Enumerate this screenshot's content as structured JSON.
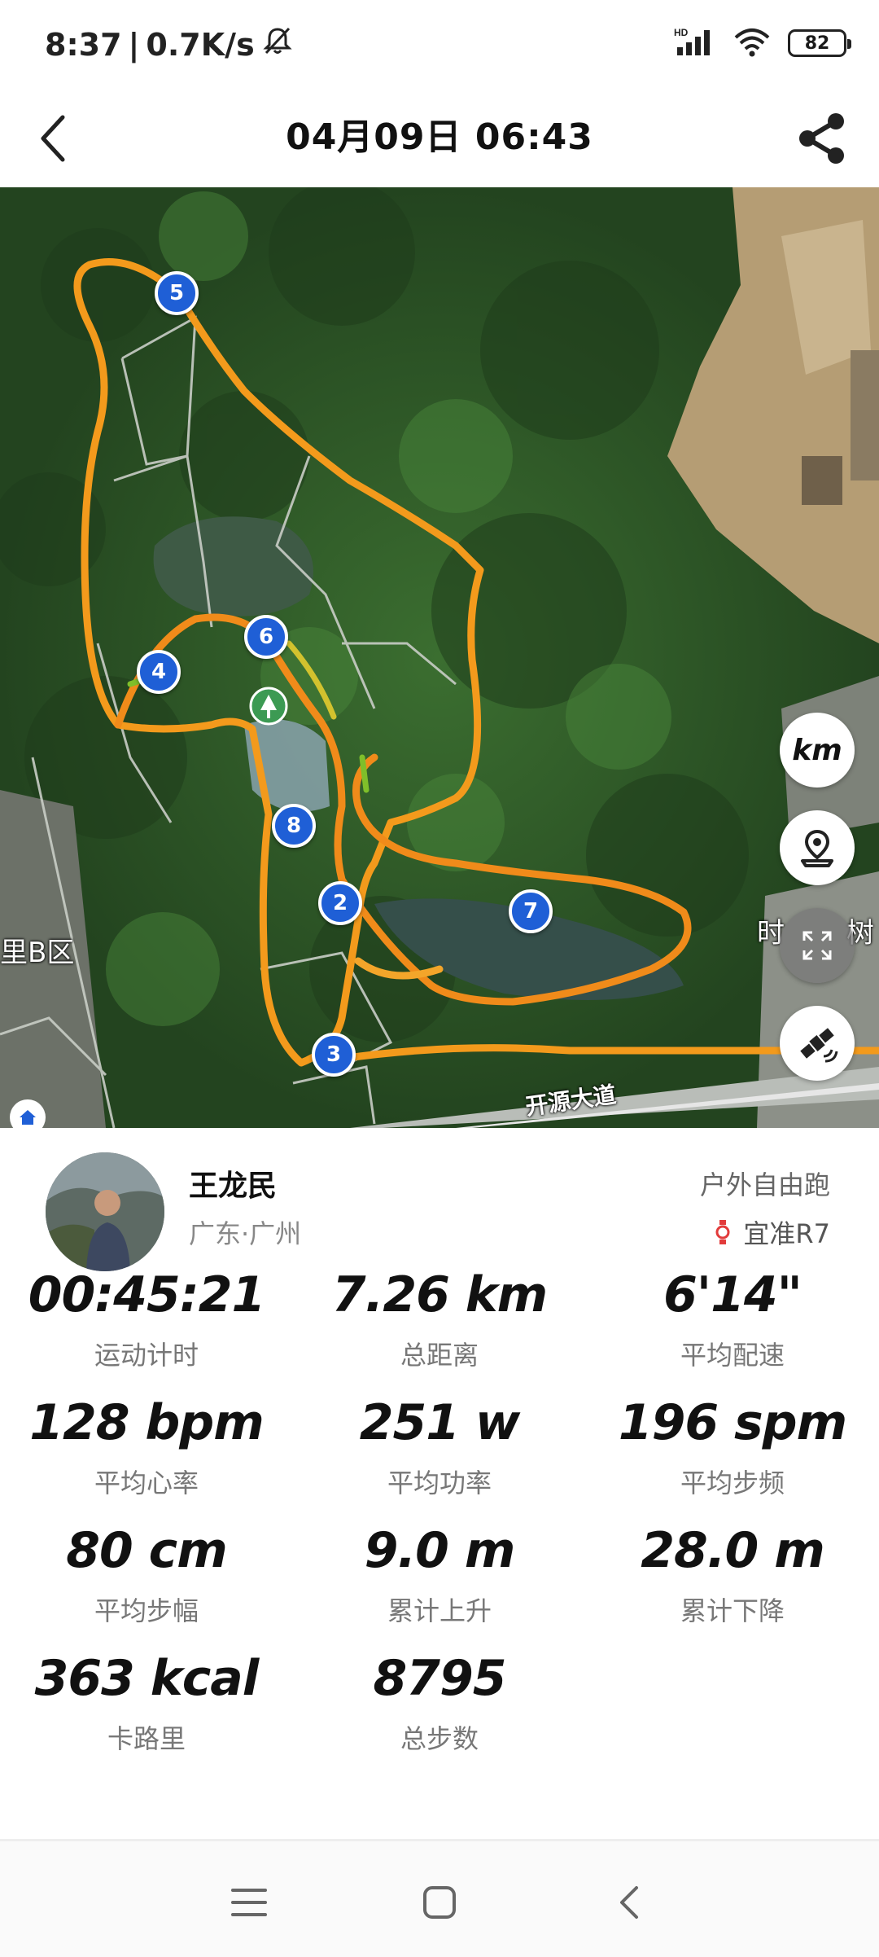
{
  "status_bar": {
    "time": "8:37",
    "separator": "|",
    "network_speed": "0.7K/s",
    "mute_icon": "bell-off-icon",
    "signal_label": "HD",
    "battery": "82"
  },
  "header": {
    "title": "04月09日 06:43",
    "back_icon": "chevron-left-icon",
    "share_icon": "share-icon"
  },
  "map": {
    "laps": [
      "5",
      "6",
      "4",
      "8",
      "2",
      "7",
      "3"
    ],
    "place_label_left": "里B区",
    "place_label_right_a": "时",
    "place_label_right_b": "树",
    "road_label": "开源大道",
    "buttons": {
      "unit": "km",
      "location_icon": "map-pin-icon",
      "fullscreen_icon": "expand-icon",
      "satellite_icon": "satellite-icon"
    },
    "colors": {
      "route": "#f39a1c",
      "lap_marker": "#1f5fd6"
    }
  },
  "profile": {
    "name": "王龙民",
    "location": "广东·广州",
    "sport_type": "户外自由跑",
    "device": "宜准R7"
  },
  "stats": [
    {
      "value": "00:45:21",
      "label": "运动计时"
    },
    {
      "value": "7.26 km",
      "label": "总距离"
    },
    {
      "value": "6'14\"",
      "label": "平均配速"
    },
    {
      "value": "128 bpm",
      "label": "平均心率"
    },
    {
      "value": "251 w",
      "label": "平均功率"
    },
    {
      "value": "196 spm",
      "label": "平均步频"
    },
    {
      "value": "80 cm",
      "label": "平均步幅"
    },
    {
      "value": "9.0 m",
      "label": "累计上升"
    },
    {
      "value": "28.0 m",
      "label": "累计下降"
    },
    {
      "value": "363 kcal",
      "label": "卡路里"
    },
    {
      "value": "8795",
      "label": "总步数"
    }
  ],
  "nav": {
    "menu_icon": "menu-icon",
    "home_icon": "home-square-icon",
    "back_icon": "back-icon"
  }
}
